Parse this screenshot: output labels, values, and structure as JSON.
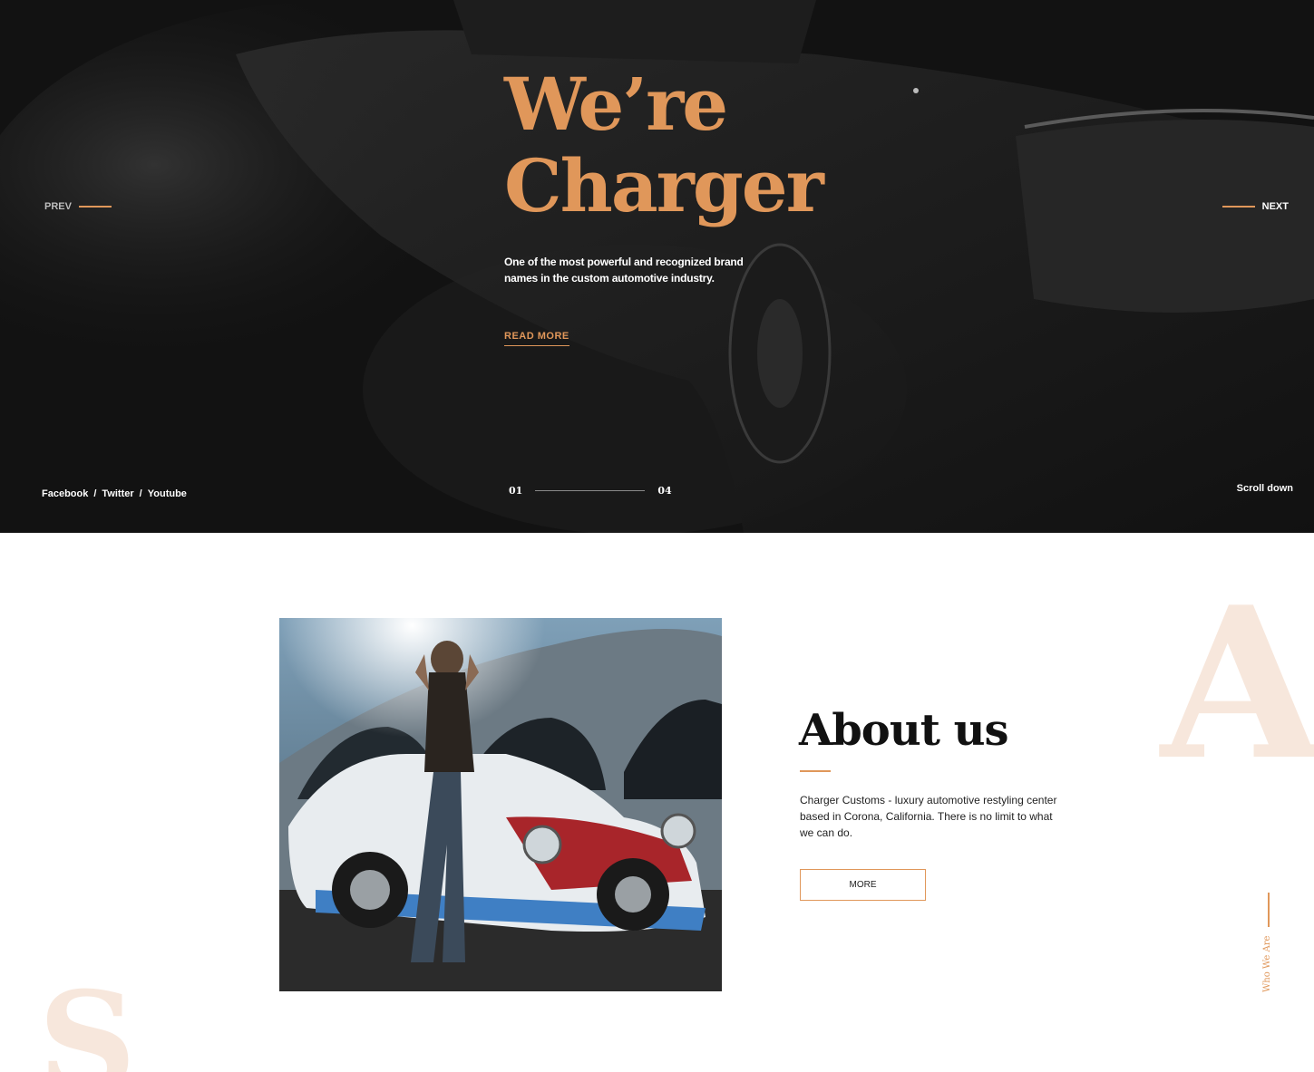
{
  "hero": {
    "title_line1": "We’re",
    "title_line2": "Charger",
    "subtitle": "One of the most powerful and recognized brand names in the custom automotive industry.",
    "read_more": "READ MORE",
    "prev": "PREV",
    "next": "NEXT",
    "socials": [
      "Facebook",
      "Twitter",
      "Youtube"
    ],
    "social_separator": "/",
    "pager_current": "01",
    "pager_total": "04",
    "scroll_down": "Scroll down"
  },
  "about": {
    "title": "About us",
    "text": "Charger Customs - luxury automotive restyling center based in Corona, California. There is no limit to what we can do.",
    "more": "MORE",
    "side_label": "Who We Are",
    "decor_letter": "A",
    "decor_letter_bottom": "S"
  },
  "colors": {
    "accent": "#e0975a",
    "decor": "#f7e7dc",
    "hero_bg": "#141414"
  },
  "icons": [
    "prev-line-icon",
    "next-line-icon"
  ]
}
